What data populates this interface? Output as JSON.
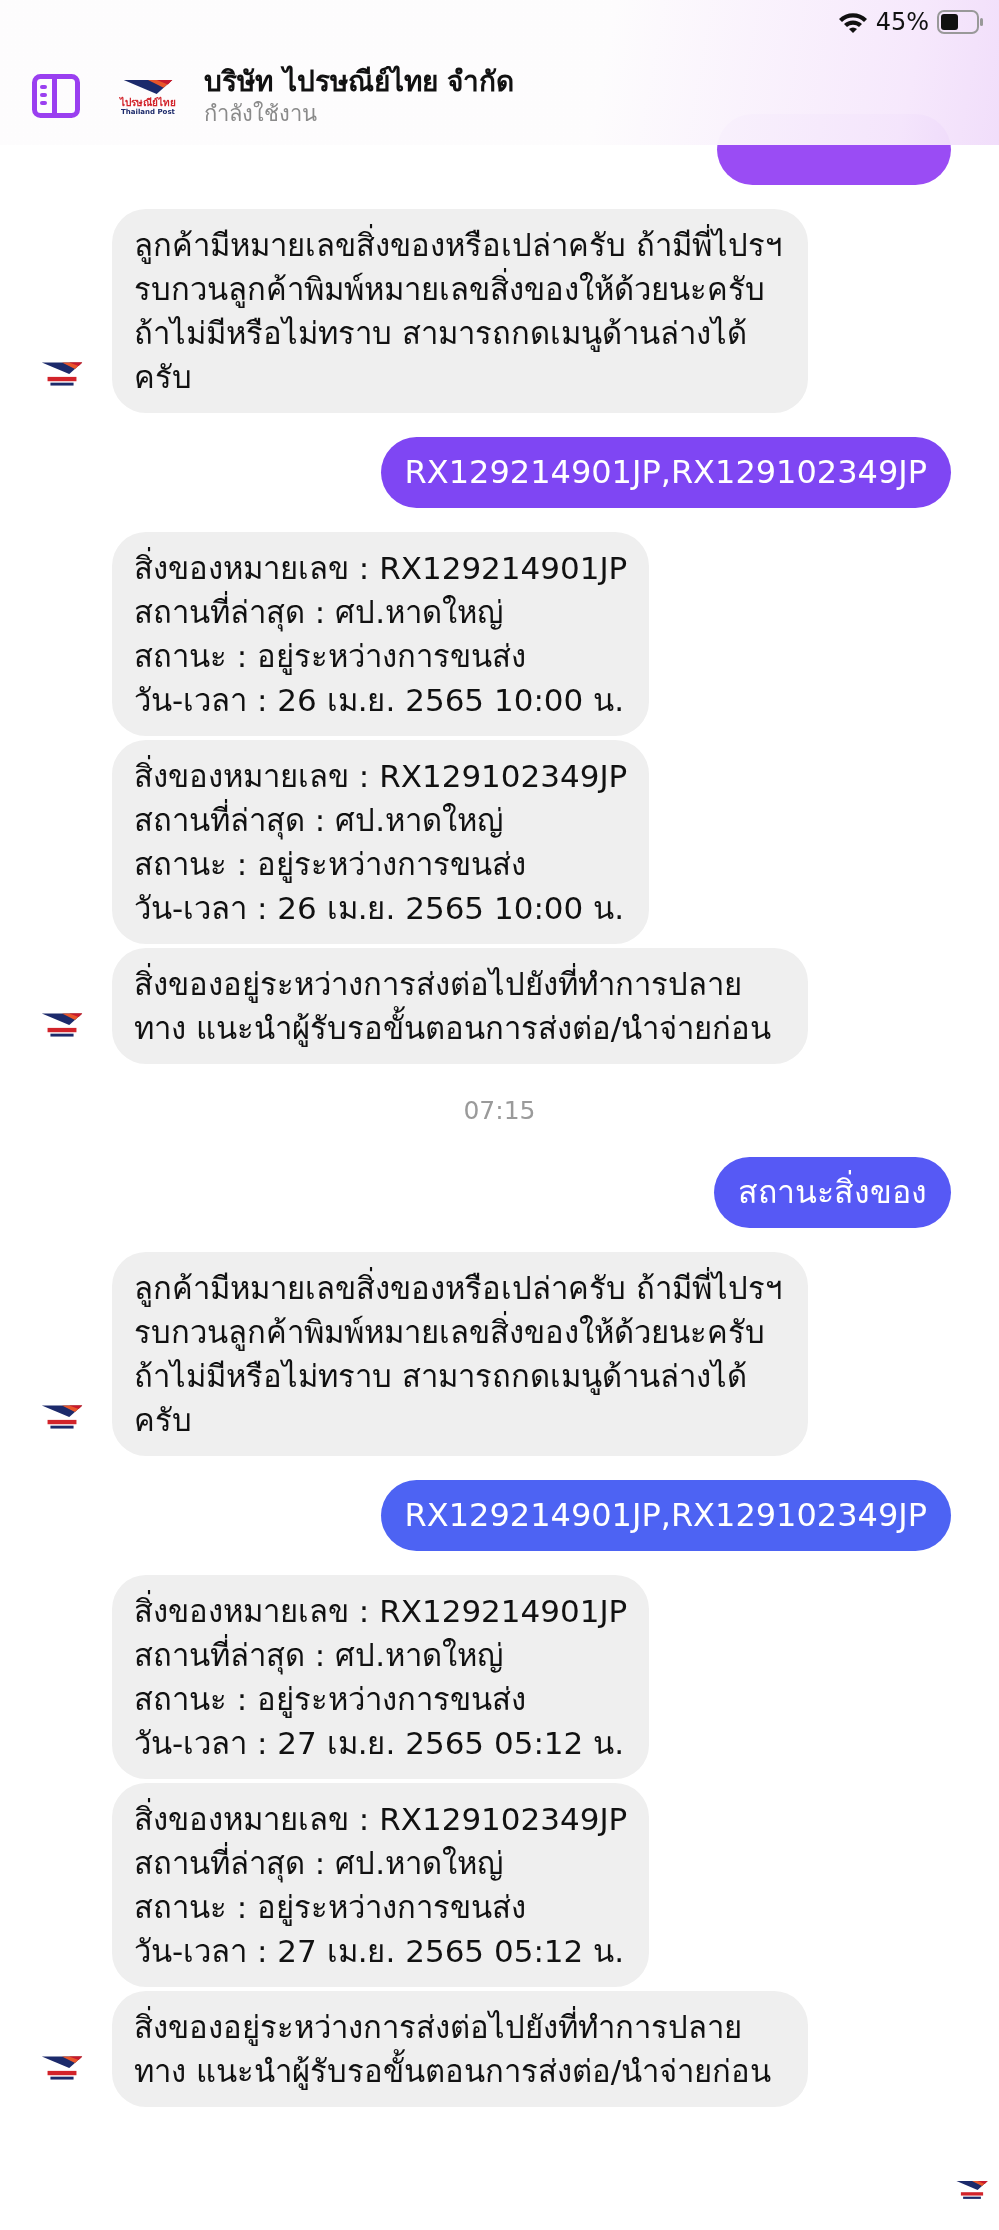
{
  "status_bar": {
    "battery": "45%"
  },
  "header": {
    "title": "บริษัท ไปรษณีย์ไทย จำกัด",
    "status": "กำลังใช้งาน",
    "logo": {
      "name_th": "ไปรษณีย์ไทย",
      "name_en": "Thailand Post"
    }
  },
  "conversation": [
    {
      "kind": "sent",
      "color": "#9a4cf4"
    },
    {
      "kind": "received",
      "messages": [
        {
          "text": "ลูกค้ามีหมายเลขสิ่งของหรือเปล่าครับ ถ้ามีพี่ไปรฯ รบกวนลูกค้าพิมพ์หมายเลขสิ่งของให้ด้วยนะครับ ถ้าไม่มีหรือไม่ทราบ สามารถกดเมนูด้านล่างได้ครับ"
        }
      ]
    },
    {
      "kind": "sent",
      "color": "#7f46f3",
      "text": "RX129214901JP,RX129102349JP"
    },
    {
      "kind": "received",
      "messages": [
        {
          "lines": [
            "สิ่งของหมายเลข : RX129214901JP",
            "สถานที่ล่าสุด : ศป.หาดใหญ่",
            "สถานะ : อยู่ระหว่างการขนส่ง",
            "วัน-เวลา : 26 เม.ย. 2565 10:00 น."
          ]
        },
        {
          "lines": [
            "สิ่งของหมายเลข : RX129102349JP",
            "สถานที่ล่าสุด : ศป.หาดใหญ่",
            "สถานะ : อยู่ระหว่างการขนส่ง",
            "วัน-เวลา : 26 เม.ย. 2565 10:00 น."
          ]
        },
        {
          "text": "สิ่งของอยู่ระหว่างการส่งต่อไปยังที่ทำการปลายทาง แนะนำผู้รับรอขั้นตอนการส่งต่อ/นำจ่ายก่อน"
        }
      ]
    },
    {
      "kind": "time",
      "text": "07:15"
    },
    {
      "kind": "sent",
      "color": "#5659f5",
      "text": "สถานะสิ่งของ"
    },
    {
      "kind": "received",
      "messages": [
        {
          "text": "ลูกค้ามีหมายเลขสิ่งของหรือเปล่าครับ ถ้ามีพี่ไปรฯ รบกวนลูกค้าพิมพ์หมายเลขสิ่งของให้ด้วยนะครับ ถ้าไม่มีหรือไม่ทราบ สามารถกดเมนูด้านล่างได้ครับ"
        }
      ]
    },
    {
      "kind": "sent",
      "color": "#4d63f3",
      "text": "RX129214901JP,RX129102349JP"
    },
    {
      "kind": "received",
      "messages": [
        {
          "lines": [
            "สิ่งของหมายเลข : RX129214901JP",
            "สถานที่ล่าสุด : ศป.หาดใหญ่",
            "สถานะ : อยู่ระหว่างการขนส่ง",
            "วัน-เวลา : 27 เม.ย. 2565 05:12 น."
          ]
        },
        {
          "lines": [
            "สิ่งของหมายเลข : RX129102349JP",
            "สถานที่ล่าสุด : ศป.หาดใหญ่",
            "สถานะ : อยู่ระหว่างการขนส่ง",
            "วัน-เวลา : 27 เม.ย. 2565 05:12 น."
          ]
        },
        {
          "text": "สิ่งของอยู่ระหว่างการส่งต่อไปยังที่ทำการปลายทาง แนะนำผู้รับรอขั้นตอนการส่งต่อ/นำจ่ายก่อน"
        }
      ]
    }
  ],
  "seen": true
}
